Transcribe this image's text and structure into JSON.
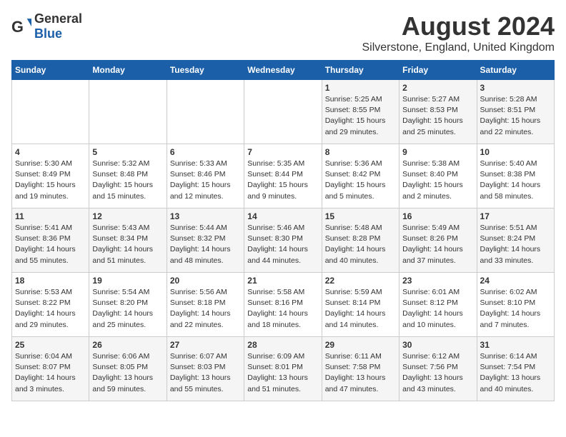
{
  "header": {
    "logo_general": "General",
    "logo_blue": "Blue",
    "month": "August 2024",
    "location": "Silverstone, England, United Kingdom"
  },
  "weekdays": [
    "Sunday",
    "Monday",
    "Tuesday",
    "Wednesday",
    "Thursday",
    "Friday",
    "Saturday"
  ],
  "weeks": [
    [
      {
        "day": "",
        "info": ""
      },
      {
        "day": "",
        "info": ""
      },
      {
        "day": "",
        "info": ""
      },
      {
        "day": "",
        "info": ""
      },
      {
        "day": "1",
        "info": "Sunrise: 5:25 AM\nSunset: 8:55 PM\nDaylight: 15 hours\nand 29 minutes."
      },
      {
        "day": "2",
        "info": "Sunrise: 5:27 AM\nSunset: 8:53 PM\nDaylight: 15 hours\nand 25 minutes."
      },
      {
        "day": "3",
        "info": "Sunrise: 5:28 AM\nSunset: 8:51 PM\nDaylight: 15 hours\nand 22 minutes."
      }
    ],
    [
      {
        "day": "4",
        "info": "Sunrise: 5:30 AM\nSunset: 8:49 PM\nDaylight: 15 hours\nand 19 minutes."
      },
      {
        "day": "5",
        "info": "Sunrise: 5:32 AM\nSunset: 8:48 PM\nDaylight: 15 hours\nand 15 minutes."
      },
      {
        "day": "6",
        "info": "Sunrise: 5:33 AM\nSunset: 8:46 PM\nDaylight: 15 hours\nand 12 minutes."
      },
      {
        "day": "7",
        "info": "Sunrise: 5:35 AM\nSunset: 8:44 PM\nDaylight: 15 hours\nand 9 minutes."
      },
      {
        "day": "8",
        "info": "Sunrise: 5:36 AM\nSunset: 8:42 PM\nDaylight: 15 hours\nand 5 minutes."
      },
      {
        "day": "9",
        "info": "Sunrise: 5:38 AM\nSunset: 8:40 PM\nDaylight: 15 hours\nand 2 minutes."
      },
      {
        "day": "10",
        "info": "Sunrise: 5:40 AM\nSunset: 8:38 PM\nDaylight: 14 hours\nand 58 minutes."
      }
    ],
    [
      {
        "day": "11",
        "info": "Sunrise: 5:41 AM\nSunset: 8:36 PM\nDaylight: 14 hours\nand 55 minutes."
      },
      {
        "day": "12",
        "info": "Sunrise: 5:43 AM\nSunset: 8:34 PM\nDaylight: 14 hours\nand 51 minutes."
      },
      {
        "day": "13",
        "info": "Sunrise: 5:44 AM\nSunset: 8:32 PM\nDaylight: 14 hours\nand 48 minutes."
      },
      {
        "day": "14",
        "info": "Sunrise: 5:46 AM\nSunset: 8:30 PM\nDaylight: 14 hours\nand 44 minutes."
      },
      {
        "day": "15",
        "info": "Sunrise: 5:48 AM\nSunset: 8:28 PM\nDaylight: 14 hours\nand 40 minutes."
      },
      {
        "day": "16",
        "info": "Sunrise: 5:49 AM\nSunset: 8:26 PM\nDaylight: 14 hours\nand 37 minutes."
      },
      {
        "day": "17",
        "info": "Sunrise: 5:51 AM\nSunset: 8:24 PM\nDaylight: 14 hours\nand 33 minutes."
      }
    ],
    [
      {
        "day": "18",
        "info": "Sunrise: 5:53 AM\nSunset: 8:22 PM\nDaylight: 14 hours\nand 29 minutes."
      },
      {
        "day": "19",
        "info": "Sunrise: 5:54 AM\nSunset: 8:20 PM\nDaylight: 14 hours\nand 25 minutes."
      },
      {
        "day": "20",
        "info": "Sunrise: 5:56 AM\nSunset: 8:18 PM\nDaylight: 14 hours\nand 22 minutes."
      },
      {
        "day": "21",
        "info": "Sunrise: 5:58 AM\nSunset: 8:16 PM\nDaylight: 14 hours\nand 18 minutes."
      },
      {
        "day": "22",
        "info": "Sunrise: 5:59 AM\nSunset: 8:14 PM\nDaylight: 14 hours\nand 14 minutes."
      },
      {
        "day": "23",
        "info": "Sunrise: 6:01 AM\nSunset: 8:12 PM\nDaylight: 14 hours\nand 10 minutes."
      },
      {
        "day": "24",
        "info": "Sunrise: 6:02 AM\nSunset: 8:10 PM\nDaylight: 14 hours\nand 7 minutes."
      }
    ],
    [
      {
        "day": "25",
        "info": "Sunrise: 6:04 AM\nSunset: 8:07 PM\nDaylight: 14 hours\nand 3 minutes."
      },
      {
        "day": "26",
        "info": "Sunrise: 6:06 AM\nSunset: 8:05 PM\nDaylight: 13 hours\nand 59 minutes."
      },
      {
        "day": "27",
        "info": "Sunrise: 6:07 AM\nSunset: 8:03 PM\nDaylight: 13 hours\nand 55 minutes."
      },
      {
        "day": "28",
        "info": "Sunrise: 6:09 AM\nSunset: 8:01 PM\nDaylight: 13 hours\nand 51 minutes."
      },
      {
        "day": "29",
        "info": "Sunrise: 6:11 AM\nSunset: 7:58 PM\nDaylight: 13 hours\nand 47 minutes."
      },
      {
        "day": "30",
        "info": "Sunrise: 6:12 AM\nSunset: 7:56 PM\nDaylight: 13 hours\nand 43 minutes."
      },
      {
        "day": "31",
        "info": "Sunrise: 6:14 AM\nSunset: 7:54 PM\nDaylight: 13 hours\nand 40 minutes."
      }
    ]
  ]
}
